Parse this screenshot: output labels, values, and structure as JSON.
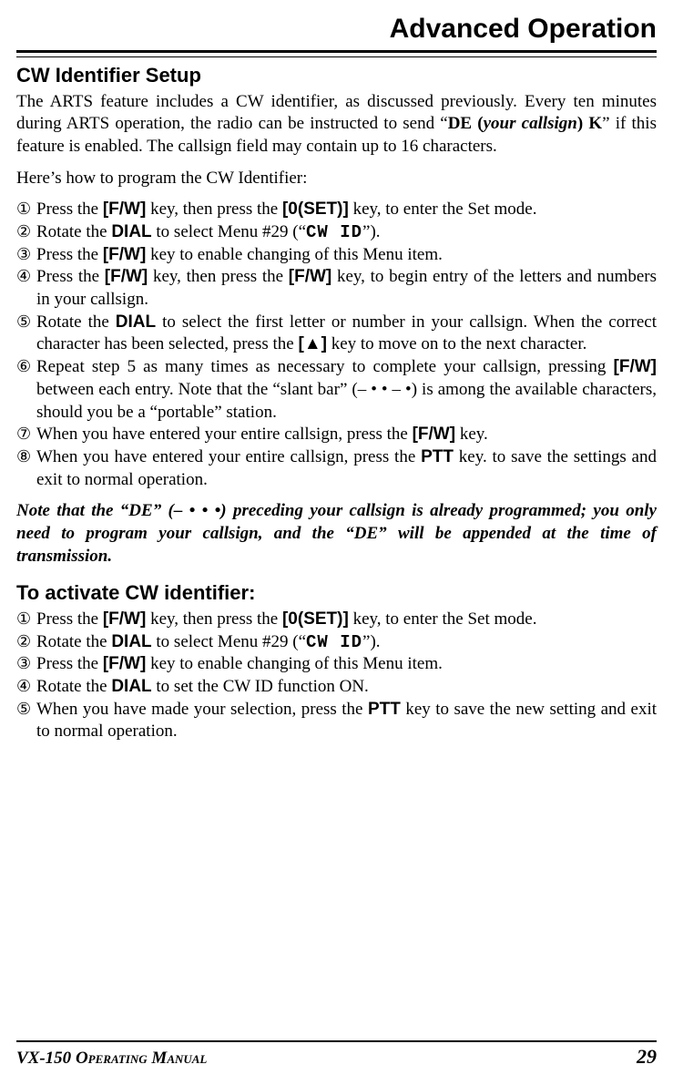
{
  "header": {
    "title": "Advanced Operation"
  },
  "section1": {
    "heading": "CW Identifier Setup",
    "para1_a": "The ARTS feature includes a CW identifier, as discussed previously. Every ten minutes during ARTS operation, the radio can be instructed to send “",
    "para1_b": "DE (",
    "para1_c": "your callsign",
    "para1_d": ") K",
    "para1_e": "” if this feature is enabled. The callsign field may contain up to 16 characters.",
    "para2": "Here’s how to program the CW Identifier:",
    "steps": [
      {
        "marker": "①",
        "pre": "Press the ",
        "k1": "[F/W]",
        "mid": " key, then press the ",
        "k2": "[0(SET)]",
        "post": " key, to enter the Set mode."
      },
      {
        "marker": "②",
        "pre": "Rotate the ",
        "k1": "DIAL",
        "mid": " to select Menu #29 (“",
        "seg": "CW ID",
        "post": "”)."
      },
      {
        "marker": "③",
        "pre": "Press the ",
        "k1": "[F/W]",
        "post": " key to enable changing of this Menu item."
      },
      {
        "marker": "④",
        "pre": "Press the ",
        "k1": "[F/W]",
        "mid": " key, then press the ",
        "k2": "[F/W]",
        "post": " key, to begin entry of the letters and numbers in your callsign."
      },
      {
        "marker": "⑤",
        "pre": "Rotate the ",
        "k1": "DIAL",
        "mid": " to select the first letter or number in your callsign. When the correct character has been selected, press the ",
        "k2": "[▲]",
        "post": " key to move on to the next character."
      },
      {
        "marker": "⑥",
        "pre": "Repeat step 5 as many times as necessary to complete your callsign, pressing ",
        "k1": "[F/W]",
        "post": " between each entry. Note that the “slant bar” (– • • – •) is among the available characters, should you be a “portable” station."
      },
      {
        "marker": "⑦",
        "pre": "When you have entered your entire callsign, press the ",
        "k1": "[F/W]",
        "post": " key."
      },
      {
        "marker": "⑧",
        "pre": "When you have entered your entire callsign, press the ",
        "k1": "PTT",
        "post": " key. to save the settings and exit to normal operation."
      }
    ],
    "note_a": "Note that the “DE” ",
    "note_b": "(– • •  •)",
    "note_c": " preceding your callsign is already programmed; you only need to program your callsign, and the “DE” will be appended at the time of transmission."
  },
  "section2": {
    "heading": "To activate CW identifier:",
    "steps": [
      {
        "marker": "①",
        "pre": "Press the ",
        "k1": "[F/W]",
        "mid": " key, then press the ",
        "k2": "[0(SET)]",
        "post": " key, to enter the Set mode."
      },
      {
        "marker": "②",
        "pre": "Rotate the ",
        "k1": "DIAL",
        "mid": " to select Menu #29 (“",
        "seg": "CW ID",
        "post": "”)."
      },
      {
        "marker": "③",
        "pre": "Press the ",
        "k1": "[F/W]",
        "post": " key to enable changing of this Menu item."
      },
      {
        "marker": "④",
        "pre": "Rotate the ",
        "k1": "DIAL",
        "post": " to set the CW ID function ON."
      },
      {
        "marker": "⑤",
        "pre": "When you have made your selection, press the ",
        "k1": "PTT",
        "post": " key to save the new setting and exit to normal operation."
      }
    ]
  },
  "footer": {
    "model": "VX-150 ",
    "manual": "Operating Manual",
    "page": "29"
  }
}
